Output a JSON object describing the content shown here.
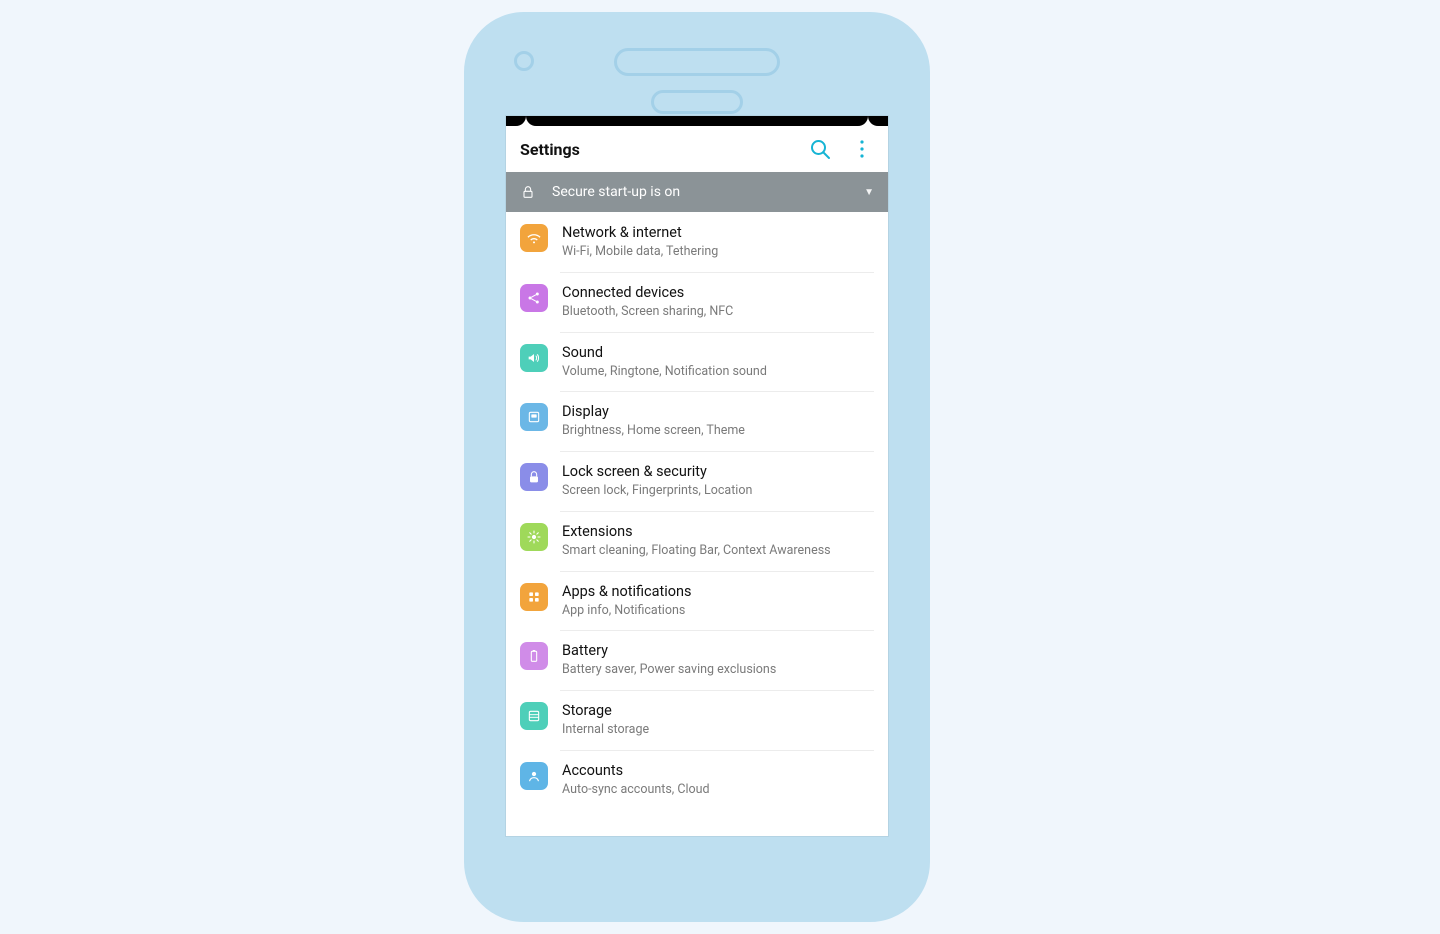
{
  "appbar": {
    "title": "Settings"
  },
  "banner": {
    "text": "Secure start-up is on"
  },
  "items": [
    {
      "title": "Network & internet",
      "sub": "Wi-Fi, Mobile data, Tethering"
    },
    {
      "title": "Connected devices",
      "sub": "Bluetooth, Screen sharing, NFC"
    },
    {
      "title": "Sound",
      "sub": "Volume, Ringtone, Notification sound"
    },
    {
      "title": "Display",
      "sub": "Brightness, Home screen, Theme"
    },
    {
      "title": "Lock screen & security",
      "sub": "Screen lock, Fingerprints, Location"
    },
    {
      "title": "Extensions",
      "sub": "Smart cleaning, Floating Bar, Context Awareness"
    },
    {
      "title": "Apps & notifications",
      "sub": "App info, Notifications"
    },
    {
      "title": "Battery",
      "sub": "Battery saver, Power saving exclusions"
    },
    {
      "title": "Storage",
      "sub": "Internal storage"
    },
    {
      "title": "Accounts",
      "sub": "Auto-sync accounts, Cloud"
    }
  ]
}
